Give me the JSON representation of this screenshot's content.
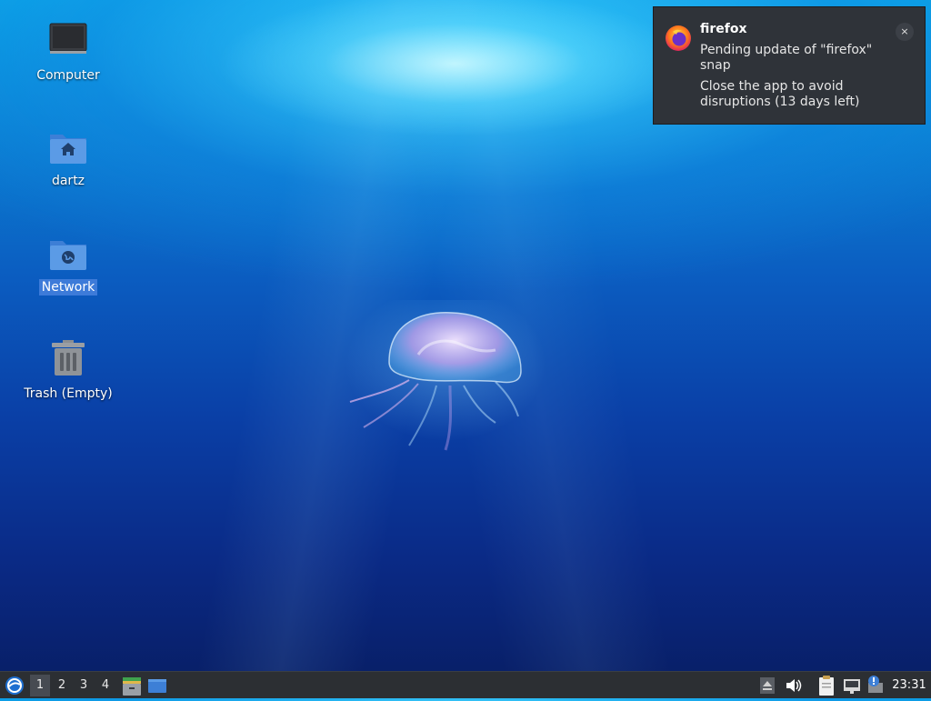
{
  "desktop": {
    "icons": [
      {
        "label": "Computer",
        "icon": "computer-icon"
      },
      {
        "label": "dartz",
        "icon": "home-folder-icon"
      },
      {
        "label": "Network",
        "icon": "network-folder-icon",
        "selected": true
      },
      {
        "label": "Trash (Empty)",
        "icon": "trash-icon"
      }
    ]
  },
  "notification": {
    "app": "firefox",
    "message": "Pending update of \"firefox\" snap",
    "detail": "Close the app to avoid disruptions (13 days left)",
    "close_label": "×",
    "icon": "firefox-icon"
  },
  "taskbar": {
    "start_icon": "lubuntu-start-icon",
    "workspaces": [
      "1",
      "2",
      "3",
      "4"
    ],
    "active_workspace": "1",
    "launchers": [
      "file-manager-icon",
      "show-desktop-icon"
    ],
    "tray": [
      "eject-icon",
      "volume-icon",
      "clipboard-icon",
      "network-icon",
      "update-notifier-icon"
    ],
    "clock": "23:31"
  },
  "colors": {
    "selection": "#3d7bd9",
    "panel": "#2c2f33",
    "notification_bg": "#2f3339"
  }
}
